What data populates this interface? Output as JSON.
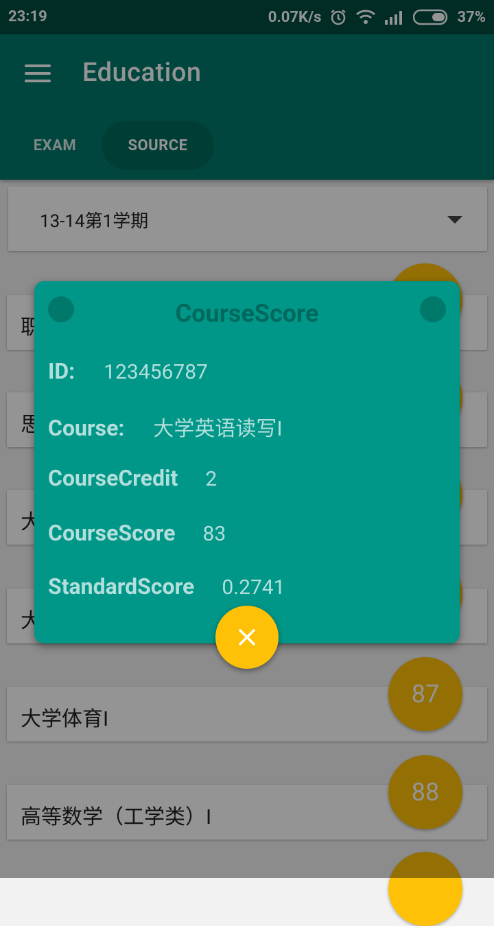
{
  "status_bar": {
    "time": "23:19",
    "speed": "0.07K/s",
    "battery": "37%"
  },
  "app_bar": {
    "title": "Education",
    "tabs": [
      {
        "label": "EXAM"
      },
      {
        "label": "SOURCE"
      }
    ]
  },
  "term_select": {
    "value": "13-14第1学期"
  },
  "courses": [
    {
      "name": "职"
    },
    {
      "name": "思"
    },
    {
      "name": "大"
    },
    {
      "name": "大"
    },
    {
      "name": "大学体育I",
      "score": "87"
    },
    {
      "name": "高等数学（工学类）I",
      "score": "88"
    }
  ],
  "dialog": {
    "title": "CourseScore",
    "id_label": "ID:",
    "id_value": "123456787",
    "course_label": "Course:",
    "course_value": "大学英语读写I",
    "credit_label": "CourseCredit",
    "credit_value": "2",
    "score_label": "CourseScore",
    "score_value": "83",
    "standard_label": "StandardScore",
    "standard_value": "0.2741"
  },
  "colors": {
    "primary": "#00796b",
    "dark": "#004d40",
    "accent": "#ffc107",
    "dialog": "#009688"
  }
}
